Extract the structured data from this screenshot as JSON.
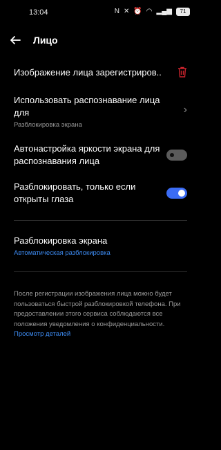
{
  "status": {
    "time": "13:04",
    "battery": "71"
  },
  "header": {
    "title": "Лицо"
  },
  "rows": {
    "face_image": {
      "label": "Изображение лица зарегистриров.."
    },
    "use_for": {
      "label": "Использовать распознавание лица для",
      "sub": "Разблокировка экрана"
    },
    "brightness": {
      "label": "Автонастройка яркости экрана для распознавания лица",
      "state": "off"
    },
    "eyes_open": {
      "label": "Разблокировать, только если открыты глаза",
      "state": "on"
    },
    "unlock": {
      "label": "Разблокировка экрана",
      "sub": "Автоматическая разблокировка"
    }
  },
  "footer": {
    "text": "После регистрации изображения лица можно будет пользоваться быстрой разблокировкой телефона. При предоставлении этого сервиса соблюдаются все положения уведомления о конфиденциальности.",
    "link": "Просмотр деталей"
  },
  "colors": {
    "accent": "#3b6cf5",
    "link": "#3d8bf2",
    "delete": "#c8232c"
  }
}
